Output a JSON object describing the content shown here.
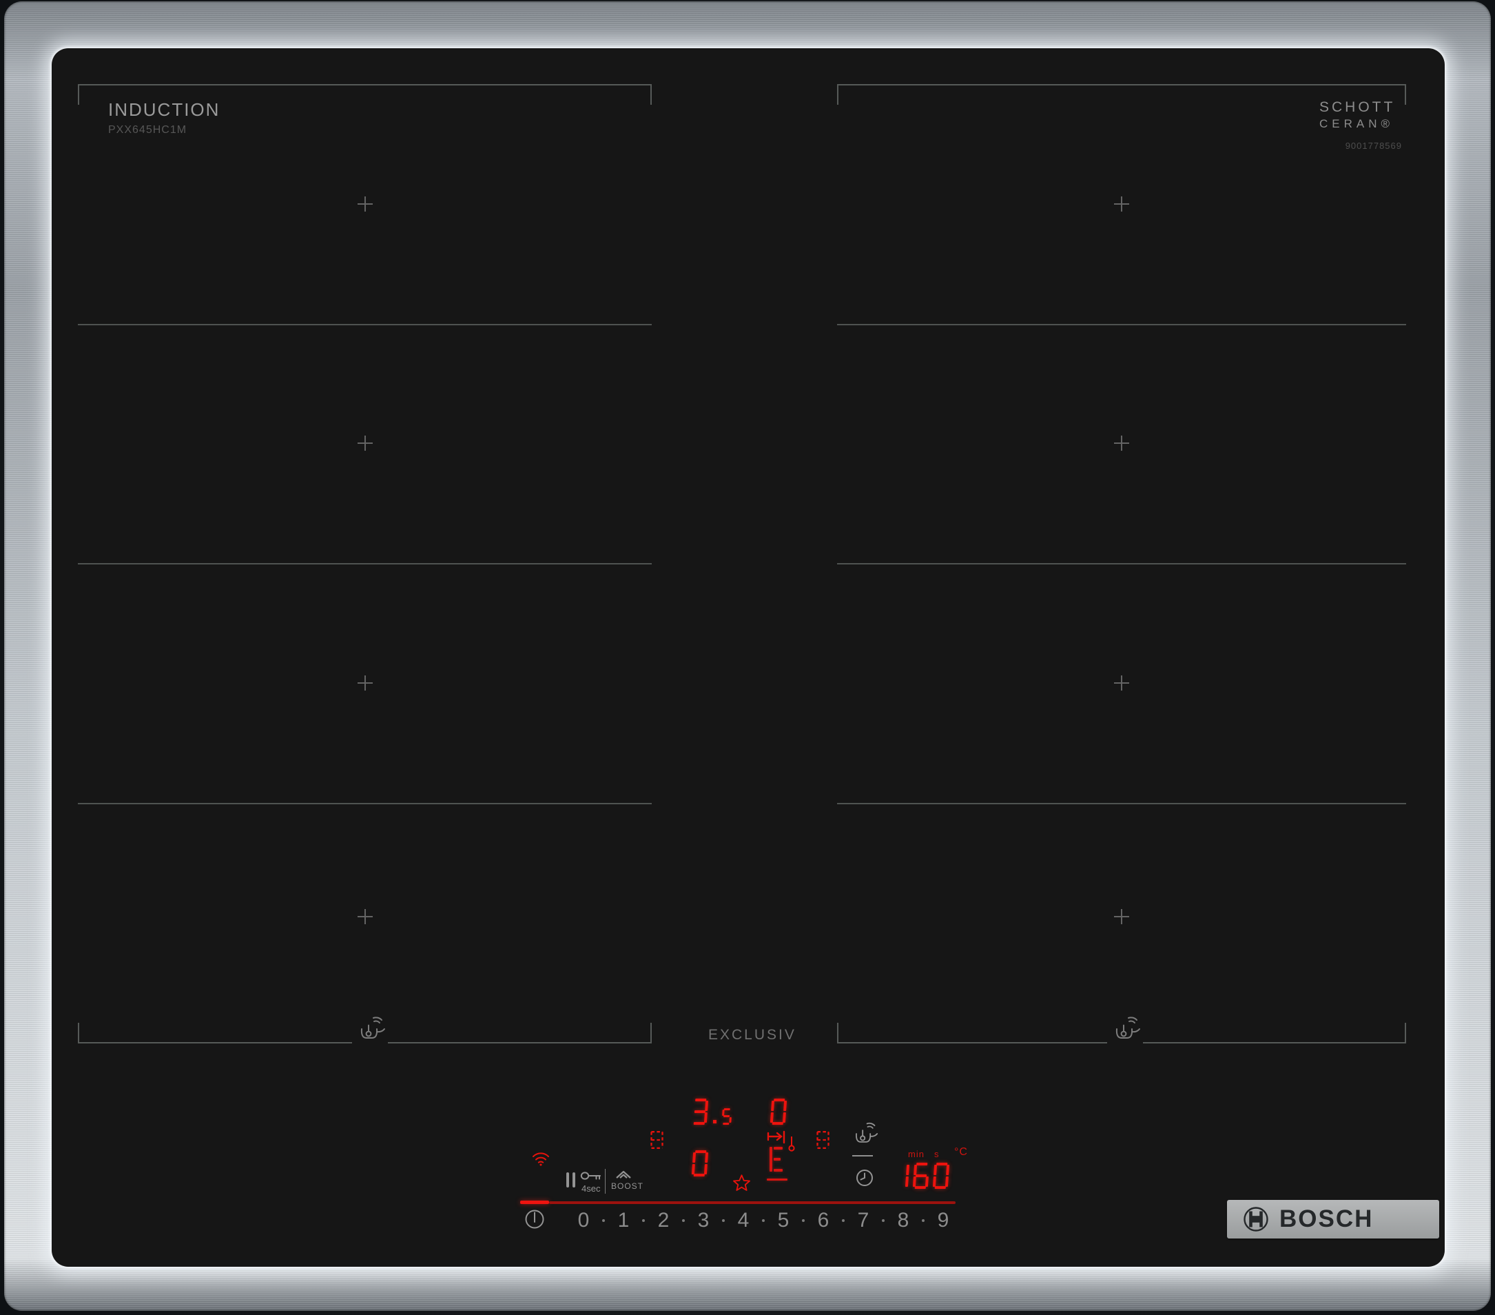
{
  "product": {
    "brand_label": "INDUCTION",
    "model": "PXX645HC1M",
    "glass_brand_line1": "SCHOTT",
    "glass_brand_line2": "CERAN®",
    "serial": "9001778569",
    "series_label": "EXCLUSIV",
    "logo_text": "BOSCH"
  },
  "zones": {
    "plus_mark": "+",
    "left_sections": 4,
    "right_sections": 4
  },
  "control": {
    "lock_label": "4sec",
    "boost_label": "BOOST",
    "levels": [
      "0",
      "1",
      "2",
      "3",
      "4",
      "5",
      "6",
      "7",
      "8",
      "9"
    ],
    "display": {
      "left_top": "3.5",
      "left_bottom": "0",
      "mid_top": "0",
      "timer": "160",
      "timer_unit_min": "min",
      "timer_unit_s": "s",
      "temp_unit": "°C"
    }
  },
  "icons": {
    "wifi-icon": "wireless connectivity indicator",
    "pause-icon": "pause two bars",
    "key-lock-icon": "childlock key, hold 4 sec",
    "boost-chevron-icon": "power boost chevron",
    "power-icon": "main on/off switch",
    "pan-sensor-icon": "frying pan with thermometer and radio waves",
    "clock-icon": "timer clock",
    "zone-link-icon": "dashed flex-zone link symbol",
    "favorite-star-icon": "favourite setting star",
    "temp-arrow-icon": "arrow-to-bar with thermometer level",
    "bosch-armature-icon": "Bosch circle armature emblem"
  },
  "colors": {
    "led_red": "#ed130e",
    "slider_red_bright": "#ee1410",
    "slider_red_dim": "#9c120e",
    "icon_gray": "#949494",
    "zone_line_gray": "#565a58",
    "glass_black": "#161616"
  }
}
